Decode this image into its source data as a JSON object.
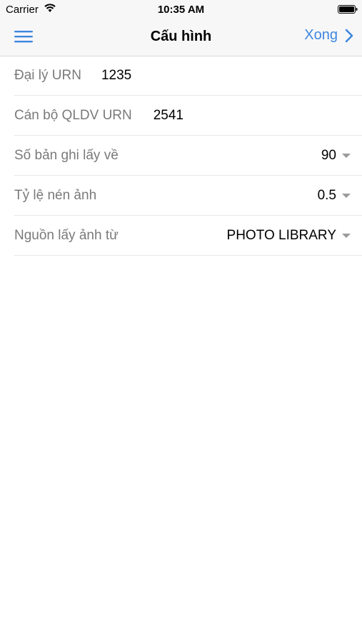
{
  "status_bar": {
    "carrier": "Carrier",
    "time": "10:35 AM"
  },
  "nav": {
    "title": "Cấu hình",
    "done_label": "Xong",
    "accent_color": "#3d87e0"
  },
  "settings": {
    "agent_urn": {
      "label": "Đại lý URN",
      "value": "1235"
    },
    "officer_urn": {
      "label": "Cán bộ QLDV URN",
      "value": "2541"
    },
    "record_count": {
      "label": "Số bản ghi lấy về",
      "value": "90"
    },
    "compression": {
      "label": "Tỷ lệ nén ảnh",
      "value": "0.5"
    },
    "image_source": {
      "label": "Nguồn lấy ảnh từ",
      "value": "PHOTO LIBRARY"
    }
  }
}
